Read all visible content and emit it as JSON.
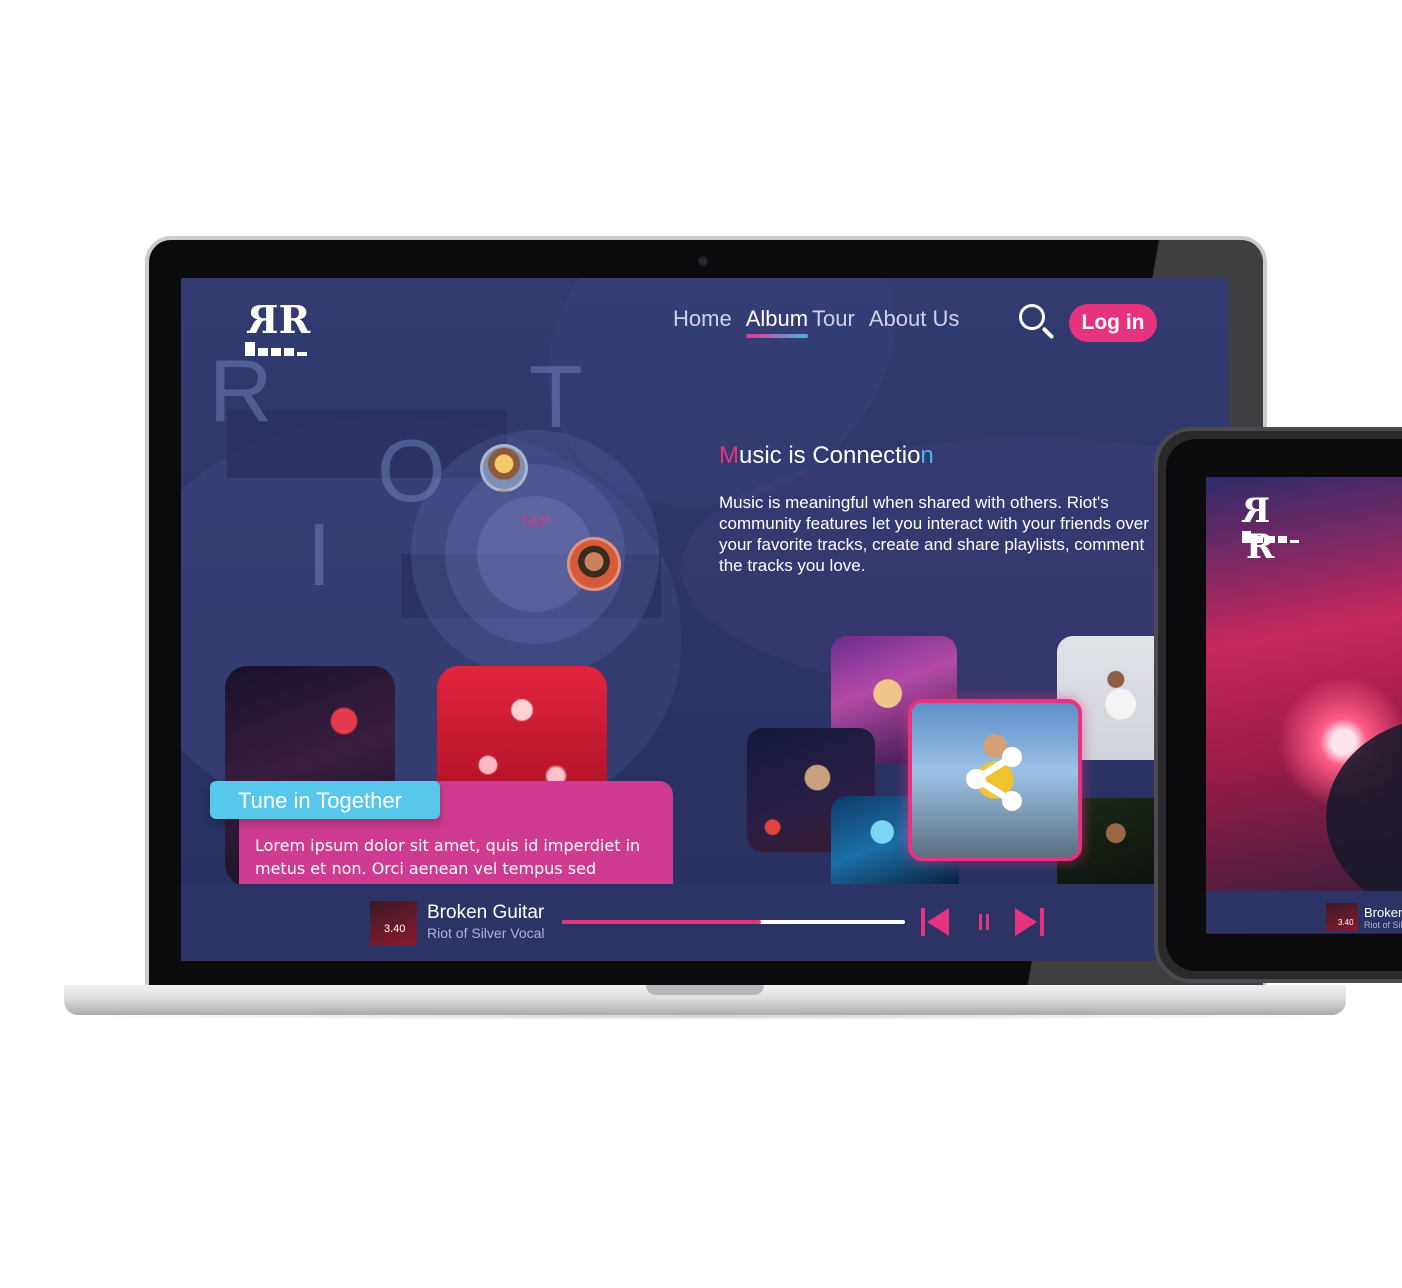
{
  "brand": {
    "logo_text": "RR"
  },
  "nav": {
    "items": [
      {
        "label": "Home"
      },
      {
        "label": "Album",
        "active": true
      },
      {
        "label": "Tour"
      },
      {
        "label": "About Us"
      }
    ],
    "search_icon": "search-icon",
    "login_label": "Log in"
  },
  "hero": {
    "riot_letters": [
      "R",
      "O",
      "T",
      "I"
    ],
    "tap_label": "TAP",
    "headline": {
      "first": "M",
      "middle": "usic is Connectio",
      "last": "n"
    },
    "body": "Music is meaningful when shared with others. Riot's community features let you interact with your friends over your favorite tracks, create and share playlists, comment the tracks you love."
  },
  "feature_card": {
    "title": "Tune in Together",
    "text": "Lorem ipsum dolor sit amet, quis id imperdiet in metus et non. Orci aenean vel tempus sed habitasse,"
  },
  "gallery": {
    "share_icon": "share-icon"
  },
  "player": {
    "track_title": "Broken Guitar",
    "artist": "Riot of Silver Vocal",
    "time": "3.40",
    "progress": 0.58,
    "icons": [
      "previous-icon",
      "pause-icon",
      "next-icon"
    ]
  },
  "tablet": {
    "track_title": "Broken Guitar",
    "artist": "Riot of Silver Vocal",
    "time": "3.40"
  },
  "colors": {
    "accent_pink": "#e6337f",
    "accent_blue": "#41b8e8",
    "background": "#323b70"
  }
}
